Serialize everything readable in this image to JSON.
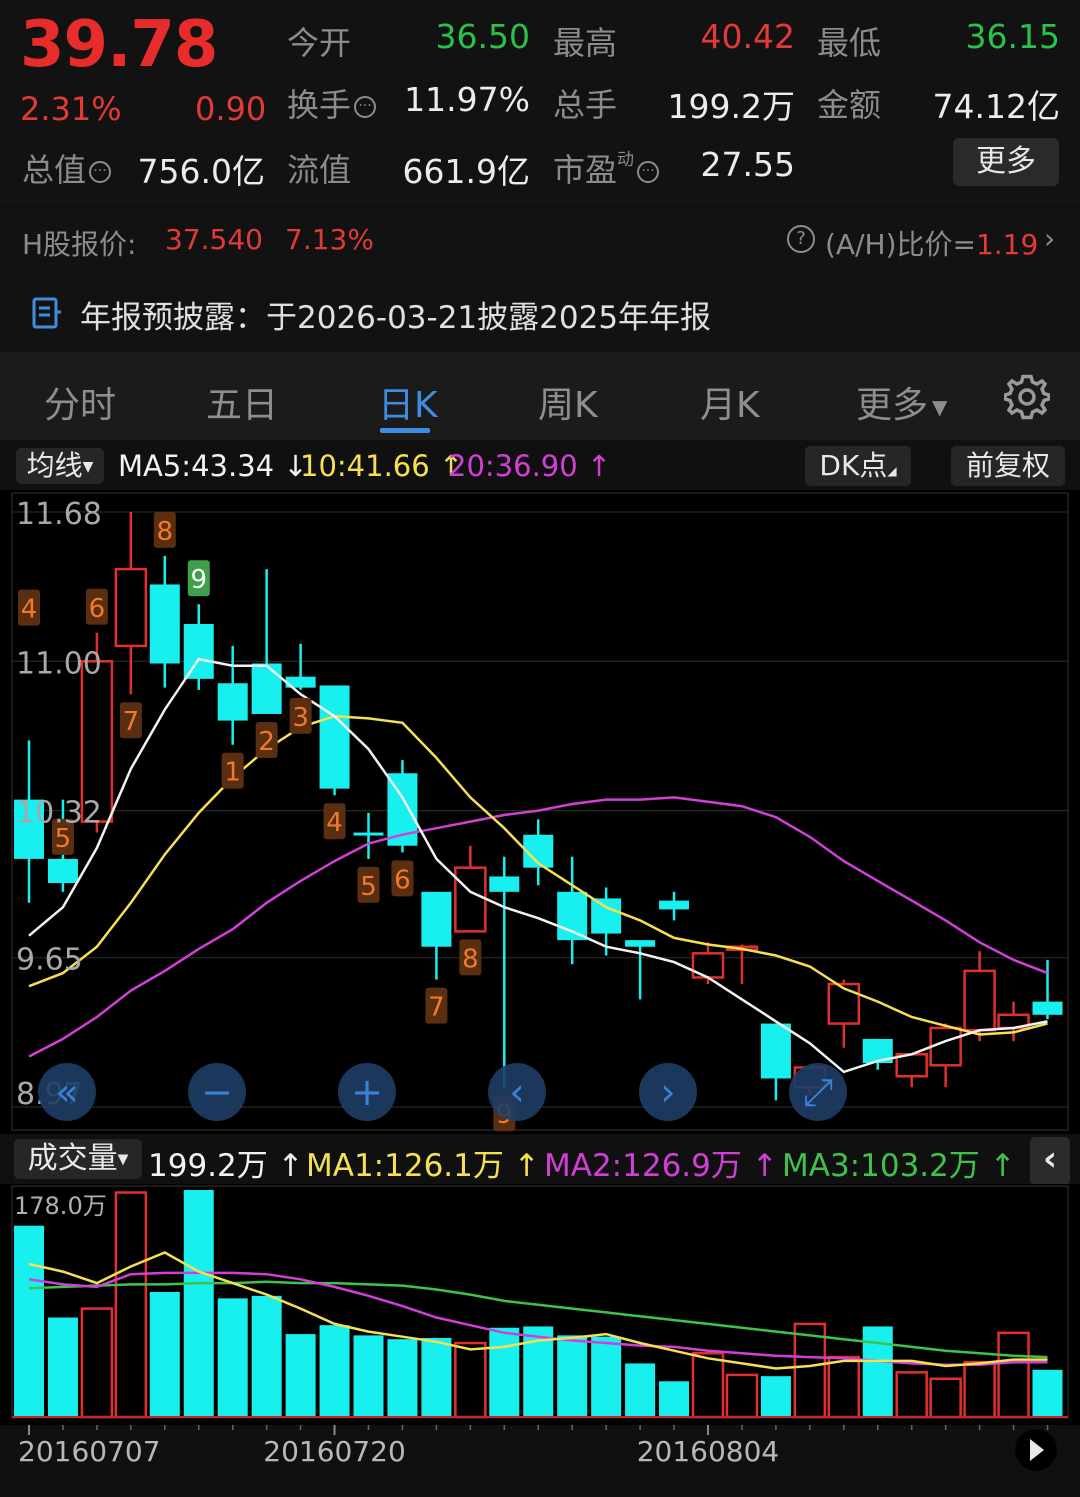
{
  "quote": {
    "price": "39.78",
    "change_pct": "2.31%",
    "change": "0.90",
    "open_label": "今开",
    "open": "36.50",
    "high_label": "最高",
    "high": "40.42",
    "low_label": "最低",
    "low": "36.15",
    "turnover_label": "换手",
    "turnover": "11.97%",
    "volume_label": "总手",
    "volume": "199.2万",
    "amount_label": "金额",
    "amount": "74.12亿",
    "mktcap_label": "总值",
    "mktcap": "756.0亿",
    "float_label": "流值",
    "float_cap": "661.9亿",
    "pe_label": "市盈",
    "pe_sup": "动",
    "pe": "27.55",
    "more_label": "更多",
    "info_icon": "circle-dots-icon"
  },
  "hshare": {
    "label": "H股报价:",
    "price": "37.540",
    "pct": "7.13%",
    "ratio_label": "(A/H)比价=",
    "ratio": "1.19",
    "help_icon": "question-circle-icon",
    "arrow_icon": "chevron-right-icon"
  },
  "notice": {
    "icon": "document-icon",
    "text": "年报预披露：于2026-03-21披露2025年年报"
  },
  "tabs": [
    {
      "label": "分时"
    },
    {
      "label": "五日"
    },
    {
      "label": "日K"
    },
    {
      "label": "周K"
    },
    {
      "label": "月K"
    },
    {
      "label": "更多"
    }
  ],
  "active_tab": "日K",
  "settings_icon": "gear-icon",
  "ma_row": {
    "selector": "均线",
    "ma5": "MA5:43.34",
    "ma10": "10:41.66",
    "ma20": "20:36.90",
    "dk_label": "DK点",
    "fq_label": "前复权",
    "colors": {
      "ma5": "#f2f2f2",
      "ma10": "#f5e052",
      "ma20": "#d23fd6"
    }
  },
  "vol_row": {
    "selector": "成交量",
    "vol": "199.2万",
    "ma1": "MA1:126.1万",
    "ma2": "MA2:126.9万",
    "ma3": "MA3:103.2万",
    "colors": {
      "ma1": "#f5e052",
      "ma2": "#d23fd6",
      "ma3": "#3fc24a"
    },
    "collapse_icon": "chevron-left-icon"
  },
  "chart_data": {
    "type": "candlestick",
    "y_ticks": [
      "11.68",
      "11.00",
      "10.32",
      "9.65",
      "8.97"
    ],
    "ylim": [
      8.97,
      11.68
    ],
    "vol_max_label": "178.0万",
    "vol_max": 178.0,
    "x_labels": [
      {
        "index": 0,
        "label": "20160707"
      },
      {
        "index": 9,
        "label": "20160720"
      },
      {
        "index": 20,
        "label": "20160804"
      }
    ],
    "candles": [
      {
        "o": 10.37,
        "h": 10.64,
        "l": 9.9,
        "c": 10.1
      },
      {
        "o": 10.1,
        "h": 10.37,
        "l": 9.95,
        "c": 9.99
      },
      {
        "o": 10.27,
        "h": 11.13,
        "l": 10.22,
        "c": 11.0
      },
      {
        "o": 11.07,
        "h": 11.68,
        "l": 10.85,
        "c": 11.42
      },
      {
        "o": 11.35,
        "h": 11.48,
        "l": 10.88,
        "c": 10.99
      },
      {
        "o": 11.17,
        "h": 11.26,
        "l": 10.87,
        "c": 10.92
      },
      {
        "o": 10.9,
        "h": 11.07,
        "l": 10.62,
        "c": 10.73
      },
      {
        "o": 10.99,
        "h": 11.42,
        "l": 10.76,
        "c": 10.76
      },
      {
        "o": 10.93,
        "h": 11.08,
        "l": 10.87,
        "c": 10.88
      },
      {
        "o": 10.89,
        "h": 10.89,
        "l": 10.39,
        "c": 10.42
      },
      {
        "o": 10.22,
        "h": 10.31,
        "l": 10.1,
        "c": 10.21
      },
      {
        "o": 10.49,
        "h": 10.55,
        "l": 10.13,
        "c": 10.16
      },
      {
        "o": 9.95,
        "h": 9.95,
        "l": 9.55,
        "c": 9.7
      },
      {
        "o": 9.77,
        "h": 10.16,
        "l": 9.77,
        "c": 10.06
      },
      {
        "o": 10.02,
        "h": 10.11,
        "l": 9.06,
        "c": 9.95
      },
      {
        "o": 10.21,
        "h": 10.28,
        "l": 9.98,
        "c": 10.06
      },
      {
        "o": 9.95,
        "h": 10.11,
        "l": 9.62,
        "c": 9.73
      },
      {
        "o": 9.92,
        "h": 9.97,
        "l": 9.66,
        "c": 9.76
      },
      {
        "o": 9.73,
        "h": 9.72,
        "l": 9.46,
        "c": 9.7
      },
      {
        "o": 9.91,
        "h": 9.95,
        "l": 9.82,
        "c": 9.87
      },
      {
        "o": 9.56,
        "h": 9.72,
        "l": 9.53,
        "c": 9.67
      },
      {
        "o": 9.7,
        "h": 9.71,
        "l": 9.53,
        "c": 9.7
      },
      {
        "o": 9.35,
        "h": 9.34,
        "l": 9.0,
        "c": 9.1
      },
      {
        "o": 9.06,
        "h": 9.13,
        "l": 9.02,
        "c": 9.15
      },
      {
        "o": 9.35,
        "h": 9.55,
        "l": 9.24,
        "c": 9.53
      },
      {
        "o": 9.28,
        "h": 9.24,
        "l": 9.14,
        "c": 9.17
      },
      {
        "o": 9.11,
        "h": 9.21,
        "l": 9.06,
        "c": 9.21
      },
      {
        "o": 9.16,
        "h": 9.35,
        "l": 9.06,
        "c": 9.33
      },
      {
        "o": 9.32,
        "h": 9.68,
        "l": 9.27,
        "c": 9.59
      },
      {
        "o": 9.33,
        "h": 9.45,
        "l": 9.27,
        "c": 9.39
      },
      {
        "o": 9.45,
        "h": 9.64,
        "l": 9.37,
        "c": 9.39
      }
    ],
    "ma5": [
      9.75,
      9.88,
      10.15,
      10.51,
      10.78,
      11.01,
      10.98,
      10.98,
      10.85,
      10.75,
      10.6,
      10.38,
      10.1,
      9.95,
      9.88,
      9.83,
      9.77,
      9.7,
      9.67,
      9.63,
      9.56,
      9.46,
      9.36,
      9.26,
      9.13,
      9.18,
      9.21,
      9.27,
      9.32,
      9.33,
      9.36
    ],
    "ma10": [
      9.52,
      9.58,
      9.7,
      9.9,
      10.12,
      10.31,
      10.47,
      10.6,
      10.7,
      10.75,
      10.74,
      10.72,
      10.56,
      10.38,
      10.24,
      10.08,
      9.98,
      9.88,
      9.82,
      9.74,
      9.71,
      9.69,
      9.66,
      9.61,
      9.51,
      9.45,
      9.38,
      9.34,
      9.3,
      9.31,
      9.35
    ],
    "ma20": [
      9.2,
      9.28,
      9.38,
      9.5,
      9.59,
      9.69,
      9.78,
      9.9,
      10.0,
      10.09,
      10.17,
      10.21,
      10.24,
      10.27,
      10.3,
      10.32,
      10.35,
      10.37,
      10.37,
      10.38,
      10.36,
      10.34,
      10.29,
      10.2,
      10.09,
      10.0,
      9.91,
      9.82,
      9.72,
      9.64,
      9.58
    ],
    "td_counts": [
      {
        "index": 0,
        "label": "4",
        "pos": "above"
      },
      {
        "index": 1,
        "label": "5",
        "pos": "above"
      },
      {
        "index": 2,
        "label": "6",
        "pos": "above"
      },
      {
        "index": 3,
        "label": "7",
        "pos": "below"
      },
      {
        "index": 4,
        "label": "8",
        "pos": "above"
      },
      {
        "index": 5,
        "label": "9",
        "pos": "above",
        "highlight": true
      },
      {
        "index": 6,
        "label": "1",
        "pos": "below"
      },
      {
        "index": 7,
        "label": "2",
        "pos": "below"
      },
      {
        "index": 8,
        "label": "3",
        "pos": "below"
      },
      {
        "index": 9,
        "label": "4",
        "pos": "below"
      },
      {
        "index": 10,
        "label": "5",
        "pos": "below"
      },
      {
        "index": 11,
        "label": "6",
        "pos": "below"
      },
      {
        "index": 12,
        "label": "7",
        "pos": "below"
      },
      {
        "index": 13,
        "label": "8",
        "pos": "below"
      },
      {
        "index": 14,
        "label": "9",
        "pos": "below"
      }
    ],
    "volumes": [
      150,
      78,
      85,
      176,
      98,
      178,
      93,
      95,
      65,
      72,
      64,
      61,
      62,
      58,
      70,
      71,
      64,
      63,
      42,
      28,
      50,
      33,
      32,
      73,
      47,
      71,
      35,
      30,
      43,
      66,
      37
    ],
    "vol_ma1": [
      120,
      114,
      105,
      118,
      129,
      114,
      105,
      96,
      85,
      73,
      67,
      63,
      59,
      53,
      55,
      60,
      62,
      65,
      58,
      52,
      46,
      42,
      38,
      40,
      44,
      44,
      44,
      40,
      42,
      45,
      45
    ],
    "vol_ma2": [
      108,
      104,
      102,
      112,
      113,
      113,
      113,
      112,
      108,
      102,
      95,
      87,
      78,
      72,
      66,
      63,
      60,
      58,
      56,
      55,
      52,
      50,
      48,
      47,
      46,
      44,
      42,
      41,
      41,
      43,
      43
    ],
    "vol_ma3": [
      101,
      102,
      103,
      104,
      104,
      105,
      105,
      106,
      105,
      105,
      104,
      103,
      100,
      96,
      91,
      88,
      85,
      82,
      79,
      76,
      73,
      70,
      67,
      64,
      61,
      58,
      55,
      52,
      50,
      48,
      47
    ],
    "overlay_controls": [
      "rewind-icon",
      "zoom-out-icon",
      "zoom-in-icon",
      "previous-icon",
      "next-icon",
      "fullscreen-icon"
    ],
    "play_icon": "play-icon"
  }
}
